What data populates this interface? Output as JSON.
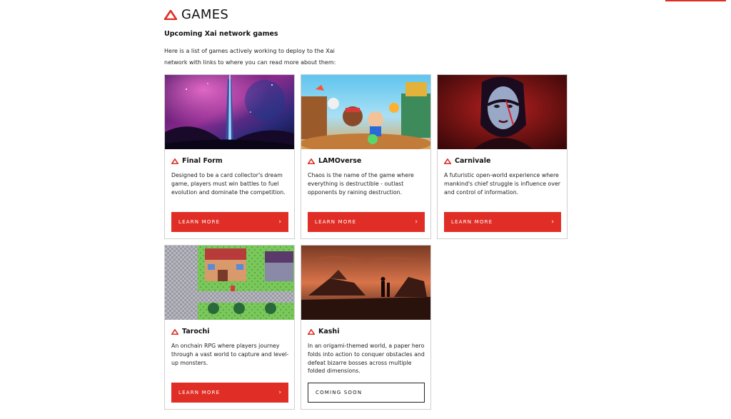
{
  "header": {
    "title": "GAMES",
    "logo_icon": "triangle-logo-icon"
  },
  "section": {
    "subtitle": "Upcoming Xai network games",
    "intro": "Here is a list of games actively working to deploy to the Xai network with links to where you can read more about them:"
  },
  "colors": {
    "accent": "#e02e26",
    "border": "#cfcfcf",
    "text": "#111111"
  },
  "cards": [
    {
      "title": "Final Form",
      "description": "Designed to be a card collector's dream game, players must win battles to fuel evolution and dominate the competition.",
      "button_label": "LEARN MORE",
      "button_icon": "chevron-right-icon"
    },
    {
      "title": "LAMOverse",
      "description": "Chaos is the name of the game where everything is destructible - outlast opponents by raining destruction.",
      "button_label": "LEARN MORE",
      "button_icon": "chevron-right-icon"
    },
    {
      "title": "Carnivale",
      "description": "A futuristic open-world experience where mankind's chief struggle is influence over and control of information.",
      "button_label": "LEARN MORE",
      "button_icon": "chevron-right-icon"
    },
    {
      "title": "Tarochi",
      "description": "An onchain RPG where players journey through a vast world to capture and level-up monsters.",
      "button_label": "LEARN MORE",
      "button_icon": "chevron-right-icon"
    },
    {
      "title": "Kashi",
      "description": "In an origami-themed world, a paper hero folds into action to conquer obstacles and defeat bizarre bosses across multiple folded dimensions.",
      "button_label": "COMING SOON"
    }
  ]
}
